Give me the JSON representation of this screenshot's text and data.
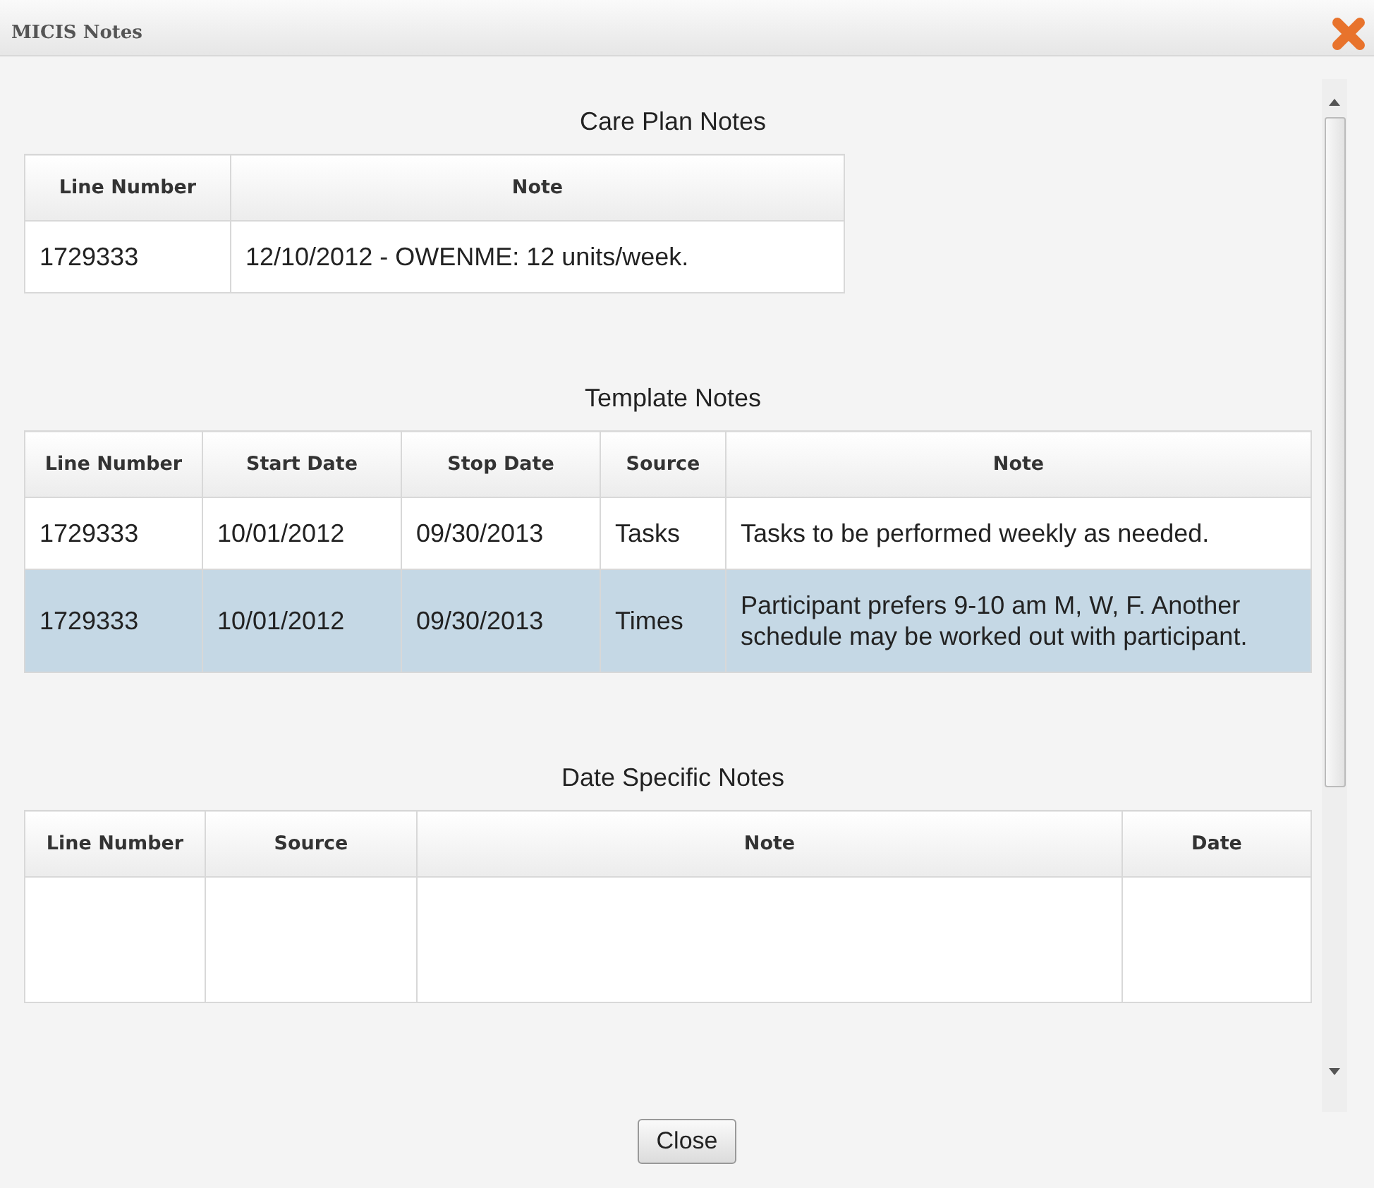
{
  "window": {
    "title": "MICIS Notes"
  },
  "sections": [
    {
      "title": "Care Plan Notes",
      "kind": "narrow",
      "columns": [
        "Line Number",
        "Note"
      ],
      "rows": [
        {
          "cells": [
            "1729333",
            "12/10/2012 - OWENME: 12 units/week."
          ],
          "selected": false
        }
      ]
    },
    {
      "title": "Template Notes",
      "kind": "wide",
      "columns": [
        "Line Number",
        "Start Date",
        "Stop Date",
        "Source",
        "Note"
      ],
      "rows": [
        {
          "cells": [
            "1729333",
            "10/01/2012",
            "09/30/2013",
            "Tasks",
            "Tasks to be performed weekly as needed."
          ],
          "selected": false
        },
        {
          "cells": [
            "1729333",
            "10/01/2012",
            "09/30/2013",
            "Times",
            "Participant prefers 9-10 am M, W, F. Another schedule may be worked out with participant."
          ],
          "selected": true
        }
      ]
    },
    {
      "title": "Date Specific Notes",
      "kind": "wide",
      "columns": [
        "Line Number",
        "Source",
        "Note",
        "Date"
      ],
      "rows": [
        {
          "cells": [],
          "selected": false
        }
      ]
    }
  ],
  "buttons": [
    "Close"
  ]
}
